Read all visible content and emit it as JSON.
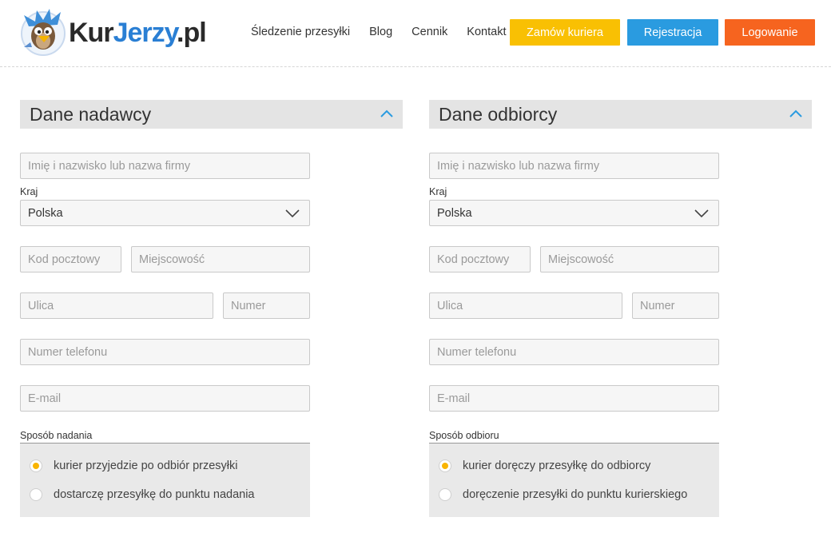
{
  "header": {
    "logo": {
      "kur": "Kur",
      "jerzy": "Jerzy",
      "pl": ".pl"
    },
    "nav": [
      {
        "label": "Śledzenie przesyłki"
      },
      {
        "label": "Blog"
      },
      {
        "label": "Cennik"
      },
      {
        "label": "Kontakt"
      }
    ],
    "buttons": {
      "order": "Zamów kuriera",
      "register": "Rejestracja",
      "login": "Logowanie"
    }
  },
  "colors": {
    "order": "#f9c003",
    "register": "#2a9be0",
    "login": "#f6641f",
    "accent": "#2a9be0",
    "radio_checked": "#f9b400"
  },
  "sender": {
    "title": "Dane nadawcy",
    "name_placeholder": "Imię i nazwisko lub nazwa firmy",
    "country_label": "Kraj",
    "country_value": "Polska",
    "postal_placeholder": "Kod pocztowy",
    "city_placeholder": "Miejscowość",
    "street_placeholder": "Ulica",
    "number_placeholder": "Numer",
    "phone_placeholder": "Numer telefonu",
    "email_placeholder": "E-mail",
    "method_label": "Sposób nadania",
    "options": [
      {
        "label": "kurier przyjedzie po odbiór przesyłki",
        "checked": true
      },
      {
        "label": "dostarczę przesyłkę do punktu nadania",
        "checked": false
      }
    ]
  },
  "recipient": {
    "title": "Dane odbiorcy",
    "name_placeholder": "Imię i nazwisko lub nazwa firmy",
    "country_label": "Kraj",
    "country_value": "Polska",
    "postal_placeholder": "Kod pocztowy",
    "city_placeholder": "Miejscowość",
    "street_placeholder": "Ulica",
    "number_placeholder": "Numer",
    "phone_placeholder": "Numer telefonu",
    "email_placeholder": "E-mail",
    "method_label": "Sposób odbioru",
    "options": [
      {
        "label": "kurier doręczy przesyłkę do odbiorcy",
        "checked": true
      },
      {
        "label": "doręczenie przesyłki do punktu kurierskiego",
        "checked": false
      }
    ]
  }
}
